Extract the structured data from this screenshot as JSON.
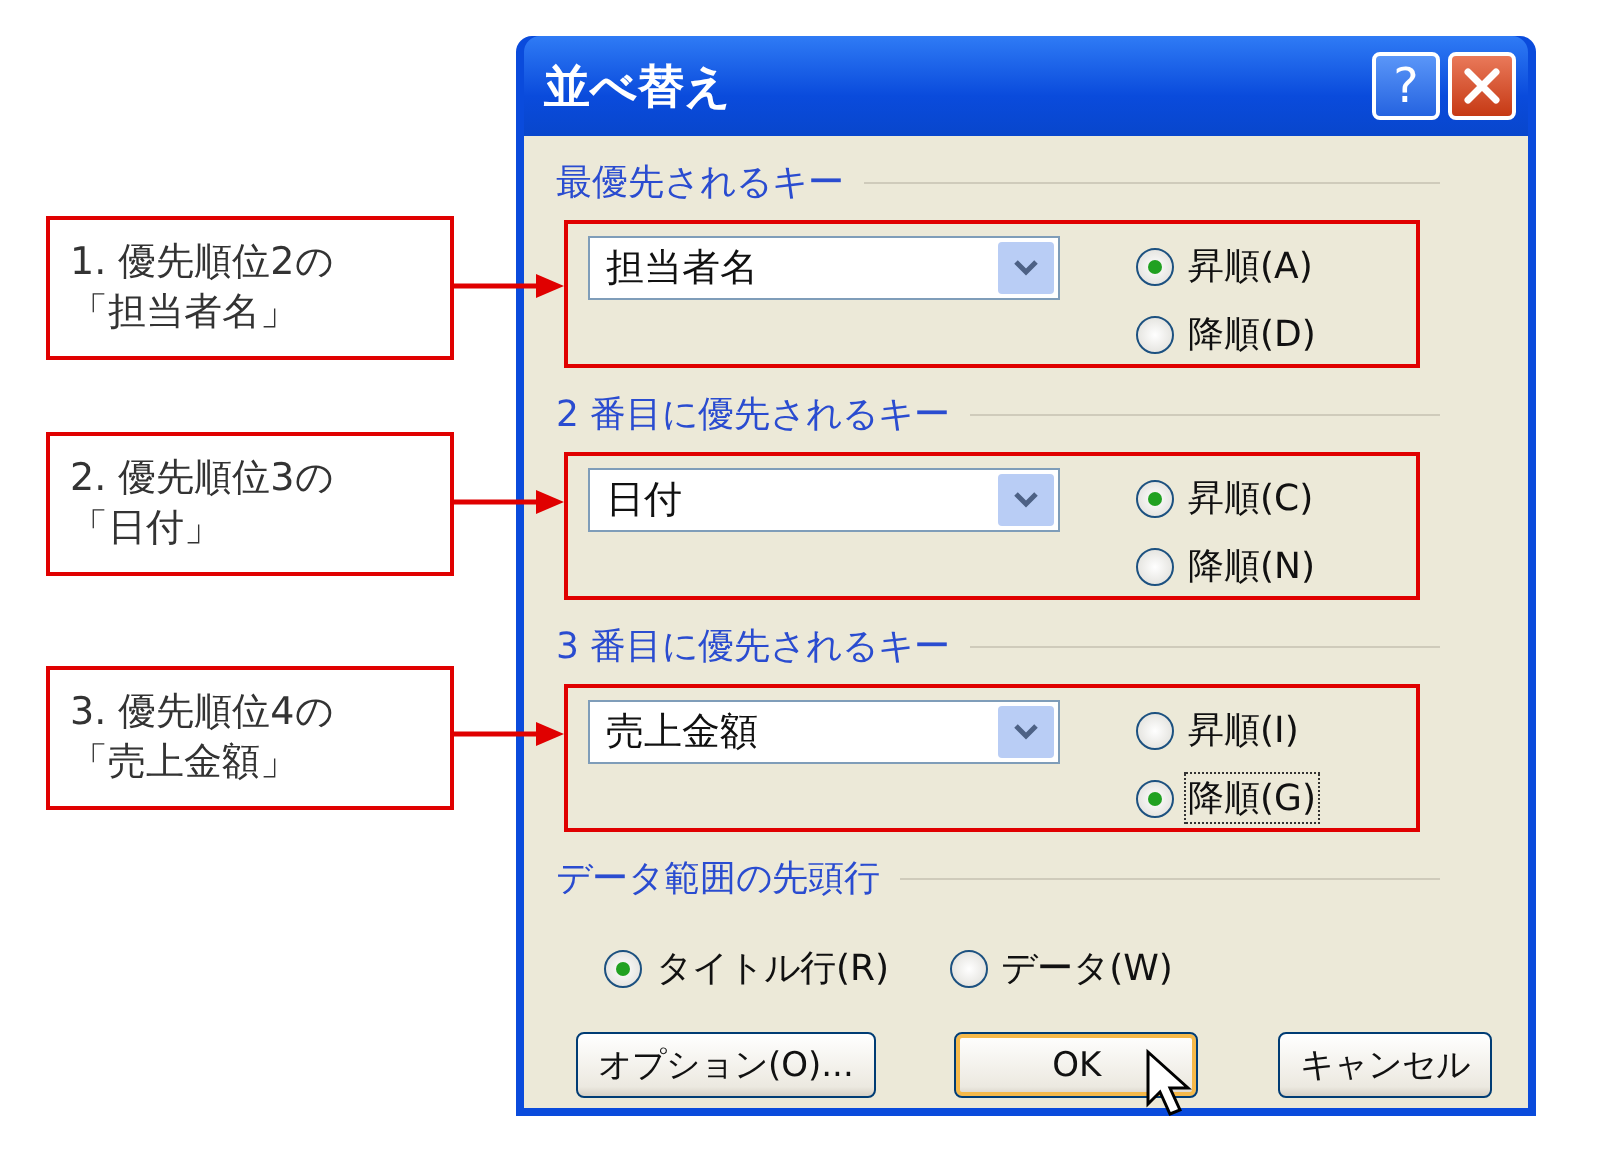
{
  "window": {
    "title": "並べ替え",
    "help_label": "?"
  },
  "sort_keys": [
    {
      "heading": "最優先されるキー",
      "value": "担当者名",
      "highlighted": true,
      "options": [
        {
          "label": "昇順(A)",
          "selected": true,
          "focused": false
        },
        {
          "label": "降順(D)",
          "selected": false,
          "focused": false
        }
      ]
    },
    {
      "heading": "2 番目に優先されるキー",
      "value": "日付",
      "highlighted": true,
      "options": [
        {
          "label": "昇順(C)",
          "selected": true,
          "focused": false
        },
        {
          "label": "降順(N)",
          "selected": false,
          "focused": false
        }
      ]
    },
    {
      "heading": "3 番目に優先されるキー",
      "value": "売上金額",
      "highlighted": true,
      "options": [
        {
          "label": "昇順(I)",
          "selected": false,
          "focused": false
        },
        {
          "label": "降順(G)",
          "selected": true,
          "focused": true
        }
      ]
    }
  ],
  "header_row": {
    "heading": "データ範囲の先頭行",
    "options": [
      {
        "label": "タイトル行(R)",
        "selected": true
      },
      {
        "label": "データ(W)",
        "selected": false
      }
    ]
  },
  "buttons": [
    {
      "label": "オプション(O)...",
      "default": false
    },
    {
      "label": "OK",
      "default": true
    },
    {
      "label": "キャンセル",
      "default": false
    }
  ],
  "callouts": [
    {
      "lines": [
        "1. 優先順位2の",
        "「担当者名」"
      ]
    },
    {
      "lines": [
        "2. 優先順位3の",
        "「日付」"
      ]
    },
    {
      "lines": [
        "3. 優先順位4の",
        "「売上金額」"
      ]
    }
  ]
}
